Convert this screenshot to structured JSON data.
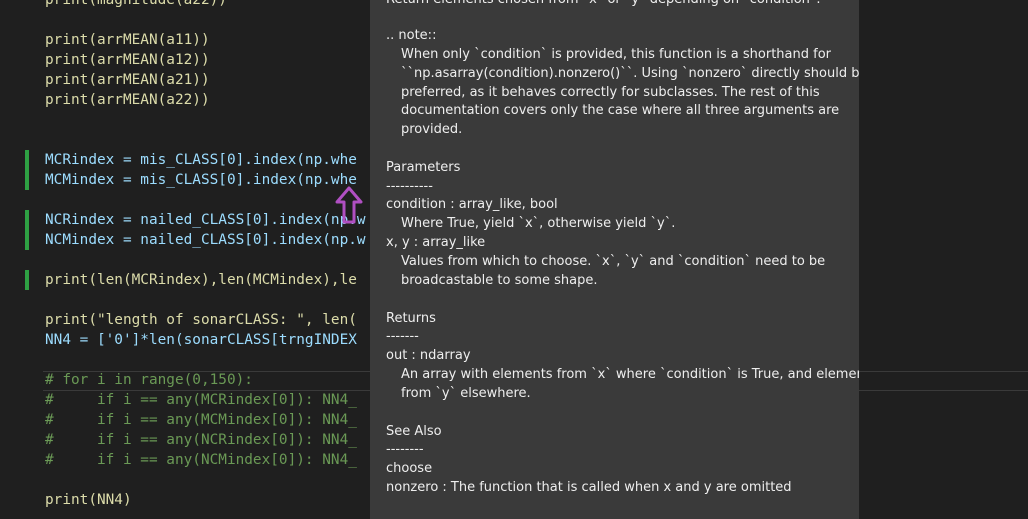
{
  "code": {
    "line0": "print(magnitude(a22))",
    "print_a11": "print(arrMEAN(a11))",
    "print_a12": "print(arrMEAN(a12))",
    "print_a21": "print(arrMEAN(a21))",
    "print_a22": "print(arrMEAN(a22))",
    "mcr": "MCRindex = mis_CLASS[0].index(np.whe",
    "mcm": "MCMindex = mis_CLASS[0].index(np.whe",
    "ncr": "NCRindex = nailed_CLASS[0].index(np.w",
    "ncm": "NCMindex = nailed_CLASS[0].index(np.w",
    "print_len": "print(len(MCRindex),len(MCMindex),le",
    "print_length": "print(\"length of sonarCLASS: \", len(",
    "nn4": "NN4 = ['0']*len(sonarCLASS[trngINDEX",
    "comment_for": "# for i in range(0,150):",
    "comment_if1": "#     if i == any(MCRindex[0]): NN4_",
    "comment_if2": "#     if i == any(MCMindex[0]): NN4_",
    "comment_if3": "#     if i == any(NCRindex[0]): NN4_",
    "comment_if4": "#     if i == any(NCMindex[0]): NN4_",
    "print_nn4": "print(NN4)"
  },
  "hover": {
    "top_cut": "Return elements chosen from `x` or `y` depending on `condition`.",
    "note_head": ".. note::",
    "note_1": "When only `condition` is provided, this function is a shorthand for",
    "note_2": "``np.asarray(condition).nonzero()``. Using `nonzero` directly should be",
    "note_3": "preferred, as it behaves correctly for subclasses. The rest of this",
    "note_4": "documentation covers only the case where all three arguments are",
    "note_5": "provided.",
    "params_head": "Parameters",
    "params_rule": "----------",
    "cond_sig": "condition : array_like, bool",
    "cond_desc": "Where True, yield `x`, otherwise yield `y`.",
    "xy_sig": "x, y : array_like",
    "xy_desc_1": "Values from which to choose. `x`, `y` and `condition` need to be",
    "xy_desc_2": "broadcastable to some shape.",
    "returns_head": "Returns",
    "returns_rule": "-------",
    "out_sig": "out : ndarray",
    "out_desc_1": "An array with elements from `x` where `condition` is True, and elements",
    "out_desc_2": "from `y` elsewhere.",
    "see_head": "See Also",
    "see_rule": "--------",
    "see_1": "choose",
    "see_2": "nonzero : The function that is called when x and y are omitted"
  },
  "colors": {
    "background": "#1f1f1f",
    "hover_bg": "#3a3a3a",
    "gutter_modified": "#2ea043",
    "cursor": "#b04fc2"
  }
}
